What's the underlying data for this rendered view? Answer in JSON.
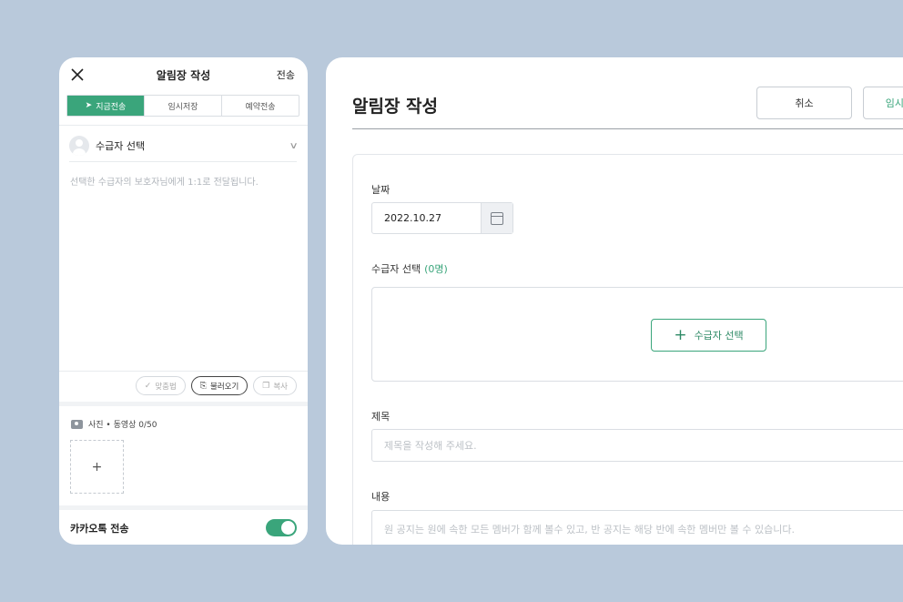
{
  "phone": {
    "title": "알림장 작성",
    "send": "전송",
    "tabs": [
      {
        "label": "지금전송",
        "icon": "cursor-icon",
        "active": true
      },
      {
        "label": "임시저장"
      },
      {
        "label": "예약전송"
      }
    ],
    "recipient_label": "수급자 선택",
    "recipient_desc": "선택한 수급자의 보호자님에게 1:1로 전달됩니다.",
    "chips": [
      {
        "label": "맞춤법",
        "icon": "spellcheck-icon"
      },
      {
        "label": "불러오기",
        "icon": "import-icon"
      },
      {
        "label": "복사",
        "icon": "copy-icon"
      }
    ],
    "media_label": "사진 • 동영상 0/50",
    "add_symbol": "+",
    "kakao_label": "카카오톡 전송",
    "kakao_enabled": true
  },
  "desktop": {
    "title": "알림장 작성",
    "cancel": "취소",
    "temp_save": "임시저장",
    "date_label": "날짜",
    "date_value": "2022.10.27",
    "recipient_label": "수급자 선택",
    "recipient_count": "(0명)",
    "recipient_button": "수급자 선택",
    "subject_label": "제목",
    "subject_placeholder": "제목을 작성해 주세요.",
    "content_label": "내용",
    "content_placeholder": "원 공지는 원에 속한 모든 멤버가 함께 볼수 있고, 반 공지는 해당 반에 속한 멤버만 볼 수 있습니다."
  },
  "colors": {
    "accent": "#3aa57b",
    "background": "#b9c9db"
  }
}
